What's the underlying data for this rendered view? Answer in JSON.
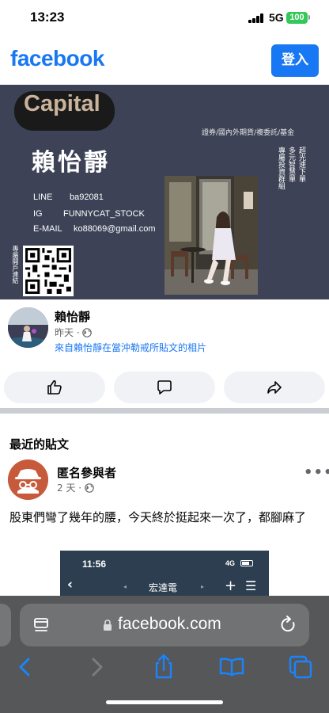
{
  "status_bar": {
    "time": "13:23",
    "network": "5G",
    "battery": "100"
  },
  "header": {
    "logo": "facebook",
    "login_label": "登入"
  },
  "post_image": {
    "brand": "Capital",
    "tagline": "證券/國內外期貨/複委託/基金",
    "name": "賴怡靜",
    "vertical_col1": "超光速下單",
    "vertical_col2": "多元智慧單",
    "vertical_col3": "專屬投資群組",
    "contacts": [
      {
        "label": "LINE",
        "value": "ba92081"
      },
      {
        "label": "IG",
        "value": "FUNNYCAT_STOCK"
      },
      {
        "label": "E-MAIL",
        "value": "ko88069@gmail.com"
      }
    ],
    "qr_side_text": "專屬開戶連結"
  },
  "post": {
    "author": "賴怡靜",
    "time": "昨天 ·",
    "source": "來自賴怡靜在當沖勒戒所貼文的相片"
  },
  "actions": [
    {
      "name": "like",
      "icon": "thumbs-up-icon"
    },
    {
      "name": "comment",
      "icon": "speech-bubble-icon"
    },
    {
      "name": "share",
      "icon": "share-arrow-icon"
    }
  ],
  "recent_section": {
    "title": "最近的貼文"
  },
  "recent_post": {
    "author": "匿名參與者",
    "time": "2 天 ·",
    "more": "•••",
    "text": "股東們彎了幾年的腰，今天終於挺起來一次了，都腳麻了",
    "embed": {
      "time": "11:56",
      "network": "4G",
      "back": "‹",
      "arrow_left": "◂",
      "title": "宏達電",
      "arrow_right": "▸",
      "plus": "+",
      "menu": "☰"
    }
  },
  "safari": {
    "address": "facebook.com"
  },
  "colors": {
    "facebook_blue": "#1877f2",
    "card_bg": "#3d4256",
    "safari_bar": "#565758",
    "ios_blue": "#1a84ff"
  }
}
